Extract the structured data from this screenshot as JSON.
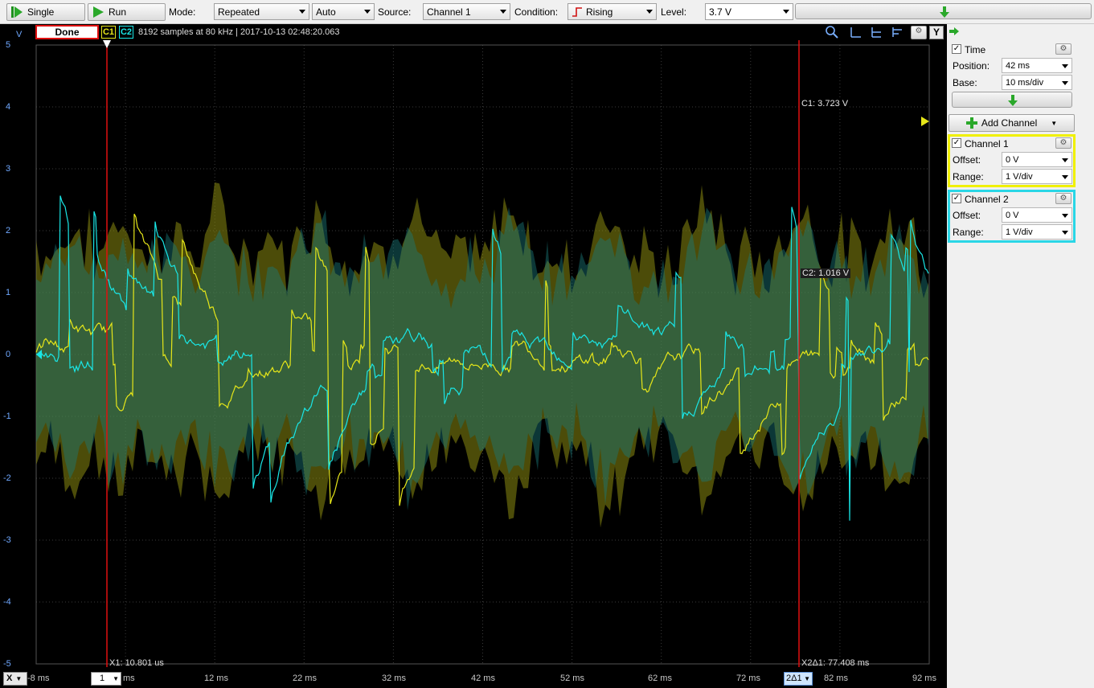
{
  "toolbar": {
    "single_label": "Single",
    "run_label": "Run",
    "mode_label": "Mode:",
    "mode_value": "Repeated",
    "auto_value": "Auto",
    "source_label": "Source:",
    "source_value": "Channel 1",
    "condition_label": "Condition:",
    "condition_value": "Rising",
    "level_label": "Level:",
    "level_value": "3.7 V"
  },
  "status": {
    "state": "Done",
    "c1": "C1",
    "c2": "C2",
    "info": "8192 samples at 80 kHz | 2017-10-13 02:48:20.063",
    "y_button": "Y"
  },
  "axis": {
    "unit": "V",
    "y_ticks": [
      "5",
      "4",
      "3",
      "2",
      "1",
      "0",
      "-1",
      "-2",
      "-3",
      "-4",
      "-5"
    ],
    "x_ticks": [
      "-8 ms",
      "12 ms",
      "22 ms",
      "32 ms",
      "42 ms",
      "52 ms",
      "62 ms",
      "72 ms",
      "82 ms",
      "92 ms"
    ],
    "x_ms": "ms",
    "x_axis_button": "X",
    "x_page_value": "1",
    "x2_button": "2Δ1"
  },
  "cursors": {
    "x1_label": "X1: 10.801 us",
    "x2_label": "X2Δ1: 77.408 ms",
    "c1_reading": "C1: 3.723 V",
    "c2_reading": "C2: 1.016 V"
  },
  "panel": {
    "time_label": "Time",
    "position_label": "Position:",
    "position_value": "42 ms",
    "base_label": "Base:",
    "base_value": "10 ms/div",
    "add_channel_label": "Add Channel",
    "ch1_label": "Channel 1",
    "ch1_offset_label": "Offset:",
    "ch1_offset_value": "0 V",
    "ch1_range_label": "Range:",
    "ch1_range_value": "1 V/div",
    "ch2_label": "Channel 2",
    "ch2_offset_label": "Offset:",
    "ch2_offset_value": "0 V",
    "ch2_range_label": "Range:",
    "ch2_range_value": "1 V/div"
  },
  "colors": {
    "ch1": "#e6e619",
    "ch2": "#19e6e6",
    "cursor": "#e01010",
    "grid": "#3a3a3a",
    "y_axis_text": "#6fa8ff"
  }
}
